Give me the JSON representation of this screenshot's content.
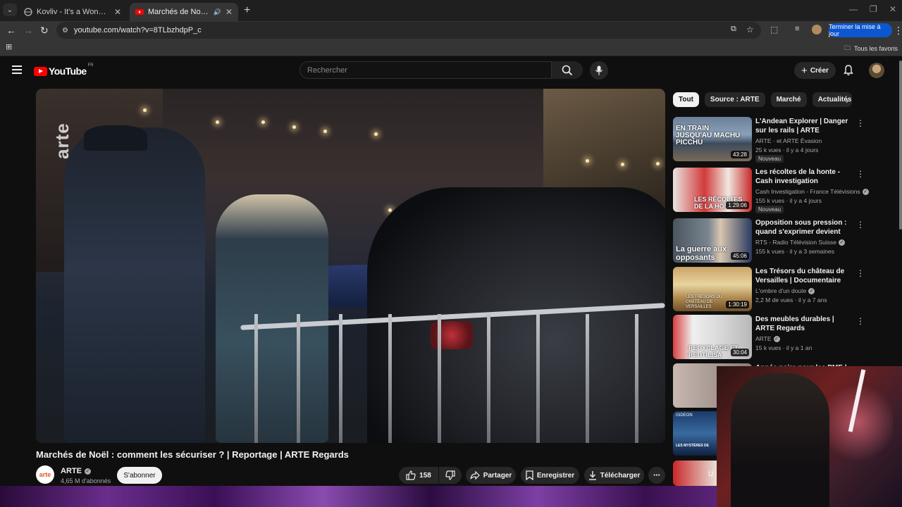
{
  "browser": {
    "tabs": [
      {
        "title": "Kovliv - It's a Wonderful Knife (",
        "active": false
      },
      {
        "title": "Marchés de Noël : commer",
        "active": true
      }
    ],
    "url": "youtube.com/watch?v=8TLbzhdpP_c",
    "update_button": "Terminer la mise à jour",
    "bookmarks_all": "Tous les favoris"
  },
  "youtube": {
    "logo_text": "YouTube",
    "logo_country": "FR",
    "search_placeholder": "Rechercher",
    "create_label": "Créer"
  },
  "video": {
    "overlay_logo": "arte",
    "title": "Marchés de Noël : comment les sécuriser ? | Reportage | ARTE Regards",
    "channel": "ARTE",
    "channel_avatar_text": "arte",
    "subscribers": "4,65 M d'abonnés",
    "subscribe_label": "S'abonner",
    "likes": "158",
    "share_label": "Partager",
    "save_label": "Enregistrer",
    "download_label": "Télécharger"
  },
  "chips": [
    "Tout",
    "Source : ARTE",
    "Marché",
    "Actualités p"
  ],
  "recommendations": [
    {
      "title": "L'Andean Explorer | Danger sur les rails | ARTE",
      "channel": "ARTE · et ARTE Évasion",
      "meta": "25 k vues · il y a 4 jours",
      "badge": "Nouveau",
      "duration": "43:28",
      "thumb_text": "EN TRAIN JUSQU'AU MACHU PICCHU",
      "verified": true
    },
    {
      "title": "Les récoltes de la honte - Cash investigation",
      "channel": "Cash Investigation - France Télévisions",
      "meta": "155 k vues · il y a 4 jours",
      "badge": "Nouveau",
      "duration": "1:29:06",
      "thumb_text": "LES RÉCOLTES DE LA HONTE",
      "verified": true
    },
    {
      "title": "Opposition sous pression : quand s'exprimer devient risqu...",
      "channel": "RTS - Radio Télévision Suisse",
      "meta": "155 k vues · il y a 3 semaines",
      "badge": "",
      "duration": "45:06",
      "thumb_text": "La guerre aux opposants",
      "verified": true
    },
    {
      "title": "Les Trésors du château de Versailles | Documentaire",
      "channel": "L'ombre d'un doute",
      "meta": "2,2 M de vues · il y a 7 ans",
      "badge": "",
      "duration": "1:30:19",
      "thumb_text": "LES TRÉSORS DU CHÂTEAU DE VERSAILLES",
      "verified": true
    },
    {
      "title": "Des meubles durables | ARTE Regards",
      "channel": "ARTE",
      "meta": "15 k vues · il y a 1 an",
      "badge": "",
      "duration": "30:04",
      "thumb_text": "RECYCLAGE ET RÉUTILISA",
      "verified": true
    },
    {
      "title": "Année noire pour les PME |",
      "channel": "",
      "meta": "",
      "badge": "",
      "duration": "",
      "thumb_text": "",
      "verified": false
    }
  ],
  "partial_thumbs": [
    "GIDEON",
    "LES MYSTÈRES DE",
    "U"
  ]
}
